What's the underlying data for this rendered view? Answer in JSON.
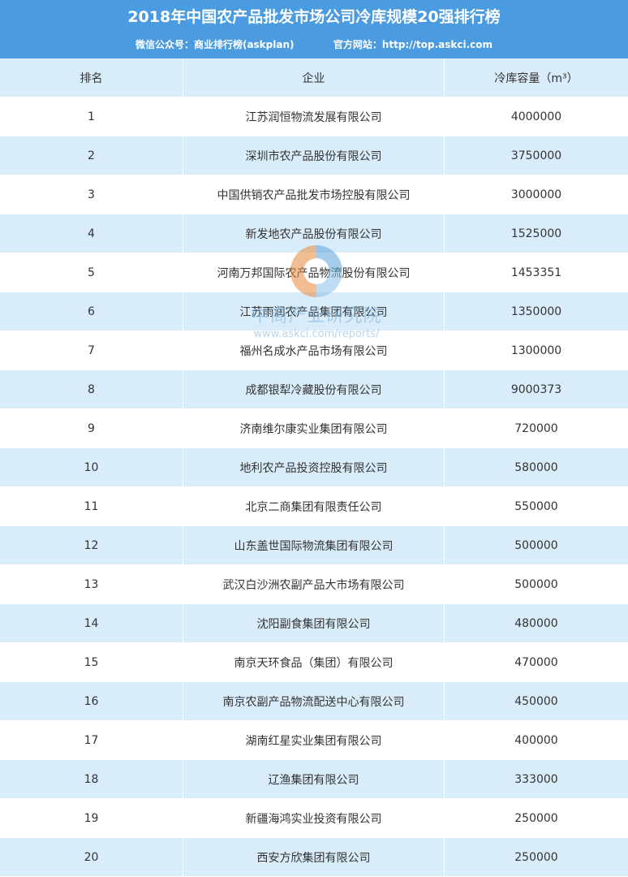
{
  "header": {
    "title": "2018年中国农产品批发市场公司冷库规模20强排行榜",
    "wechat": "微信公众号：商业排行榜(askplan)",
    "website": "官方网站：http://top.askci.com"
  },
  "table": {
    "columns": [
      "排名",
      "企业",
      "冷库容量（m³）"
    ],
    "rows": [
      [
        "1",
        "江苏润恒物流发展有限公司",
        "4000000"
      ],
      [
        "2",
        "深圳市农产品股份有限公司",
        "3750000"
      ],
      [
        "3",
        "中国供销农产品批发市场控股有限公司",
        "3000000"
      ],
      [
        "4",
        "新发地农产品股份有限公司",
        "1525000"
      ],
      [
        "5",
        "河南万邦国际农产品物流股份有限公司",
        "1453351"
      ],
      [
        "6",
        "江苏雨润农产品集团有限公司",
        "1350000"
      ],
      [
        "7",
        "福州名成水产品市场有限公司",
        "1300000"
      ],
      [
        "8",
        "成都银犁冷藏股份有限公司",
        "9000373"
      ],
      [
        "9",
        "济南维尔康实业集团有限公司",
        "720000"
      ],
      [
        "10",
        "地利农产品投资控股有限公司",
        "580000"
      ],
      [
        "11",
        "北京二商集团有限责任公司",
        "550000"
      ],
      [
        "12",
        "山东盖世国际物流集团有限公司",
        "500000"
      ],
      [
        "13",
        "武汉白沙洲农副产品大市场有限公司",
        "500000"
      ],
      [
        "14",
        "沈阳副食集团有限公司",
        "480000"
      ],
      [
        "15",
        "南京天环食品（集团）有限公司",
        "470000"
      ],
      [
        "16",
        "南京农副产品物流配送中心有限公司",
        "450000"
      ],
      [
        "17",
        "湖南红星实业集团有限公司",
        "400000"
      ],
      [
        "18",
        "辽渔集团有限公司",
        "333000"
      ],
      [
        "19",
        "新疆海鸿实业投资有限公司",
        "250000"
      ],
      [
        "20",
        "西安方欣集团有限公司",
        "250000"
      ]
    ]
  },
  "watermark": {
    "name": "中商产业研究院",
    "url": "www.askci.com/reports/"
  },
  "colors": {
    "header_bg": "#4a9be0",
    "row_alt": "#d9ecfa",
    "watermark": "#7fb3dd"
  }
}
